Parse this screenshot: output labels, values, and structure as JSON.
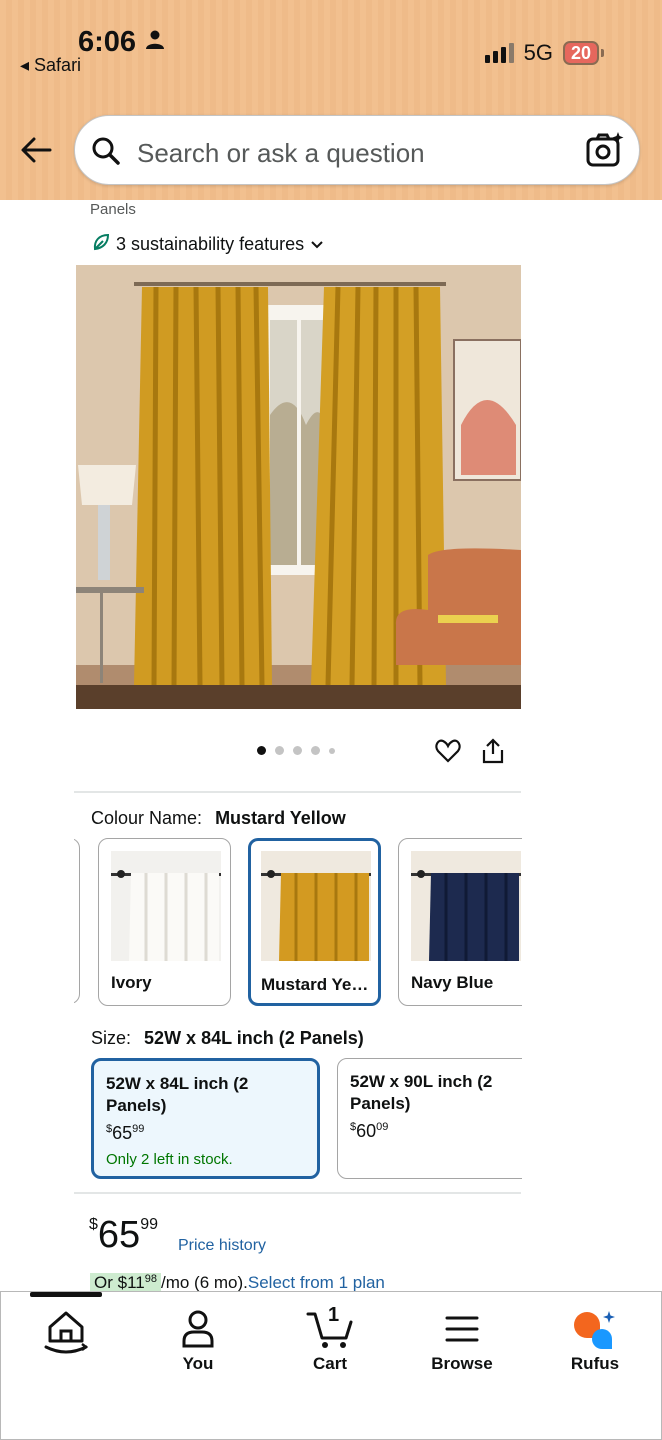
{
  "status_bar": {
    "time": "6:06",
    "back_app": "◂ Safari",
    "network": "5G",
    "battery": "20"
  },
  "search": {
    "placeholder": "Search or ask a question"
  },
  "product": {
    "breadcrumb": "Panels",
    "sustainability": "3 sustainability features",
    "image_count": 5,
    "active_image": 1
  },
  "colour": {
    "label": "Colour Name:",
    "selected": "Mustard Yellow",
    "options": [
      {
        "name": "Ivory",
        "color": "#f1efea"
      },
      {
        "name": "Mustard Yellow",
        "color": "#d39a21"
      },
      {
        "name": "Navy Blue",
        "color": "#1d2a4f"
      }
    ]
  },
  "size": {
    "label": "Size:",
    "selected": "52W x 84L inch (2 Panels)",
    "options": [
      {
        "title": "52W x 84L inch (2 Panels)",
        "price_whole": "65",
        "price_fraction": "99",
        "stock": "Only 2 left in stock."
      },
      {
        "title": "52W x 90L inch (2 Panels)",
        "price_whole": "60",
        "price_fraction": "09"
      }
    ]
  },
  "price": {
    "currency": "$",
    "whole": "65",
    "fraction": "99",
    "history_link": "Price history"
  },
  "installment": {
    "prefix": "Or $",
    "whole": "11",
    "fraction": "98",
    "suffix": "/mo (6 mo).",
    "link": "Select from 1 plan"
  },
  "bottom_nav": {
    "home": "",
    "you": "You",
    "cart": "Cart",
    "cart_count": "1",
    "browse": "Browse",
    "rufus": "Rufus"
  },
  "colors": {
    "header_bg": "#f2c08f",
    "link": "#2162a1",
    "selected_border": "#2162a1",
    "stock_green": "#007600",
    "rufus_orange": "#f3661e",
    "rufus_blue": "#1a98ff"
  }
}
